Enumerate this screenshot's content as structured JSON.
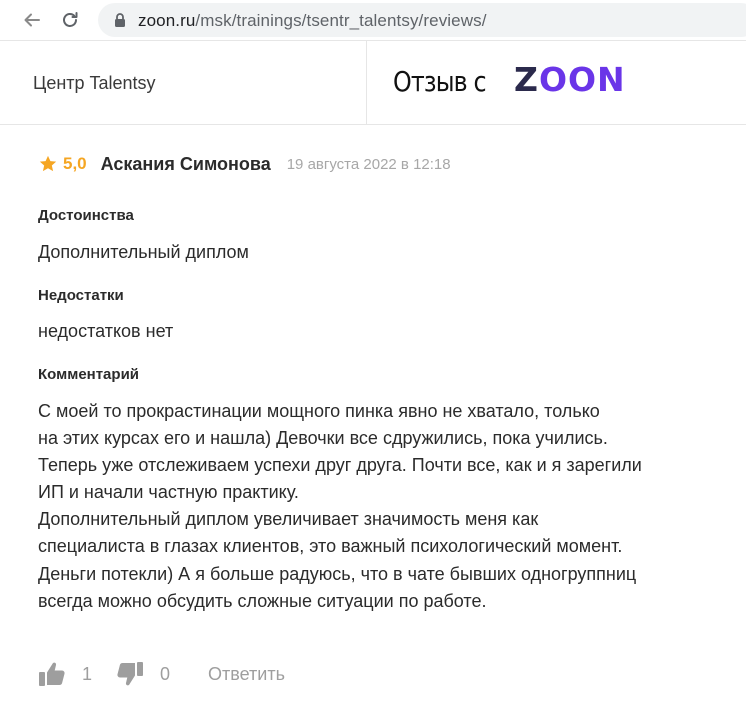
{
  "browser": {
    "url_host": "zoon.ru",
    "url_path": "/msk/trainings/tsentr_talentsy/reviews/"
  },
  "header": {
    "org_name": "Центр Talentsy",
    "review_from": "Отзыв с",
    "logo_text_first": "Z",
    "logo_text_rest": "OON",
    "logo_colors": {
      "dark": "#2b2a4c",
      "accent": "#6a35e8"
    }
  },
  "review": {
    "rating": "5,0",
    "rating_color": "#f5a623",
    "author": "Аскания Симонова",
    "date": "19 августа 2022 в 12:18",
    "pros_title": "Достоинства",
    "pros_text": "Дополнительный диплом",
    "cons_title": "Недостатки",
    "cons_text": "недостатков нет",
    "comment_title": "Комментарий",
    "comment_lines": [
      "С моей то прокрастинации мощного пинка явно не хватало, только",
      "на этих курсах его и нашла) Девочки все сдружились, пока учились.",
      "Теперь уже отслеживаем успехи друг друга. Почти все, как и я зарегили",
      "ИП и начали частную практику.",
      "Дополнительный диплом увеличивает значимость меня как",
      "специалиста в глазах клиентов, это важный психологический момент.",
      "Деньги потекли) А я больше радуюсь, что в чате бывших одногруппниц",
      "всегда можно обсудить сложные ситуации по работе."
    ]
  },
  "actions": {
    "likes": "1",
    "dislikes": "0",
    "reply_label": "Ответить"
  }
}
